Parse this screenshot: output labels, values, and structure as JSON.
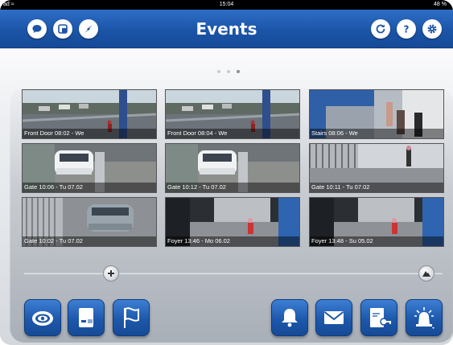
{
  "statusbar": {
    "left": "ad ≈",
    "time": "15:04",
    "right": "48 %"
  },
  "navbar": {
    "title": "Events",
    "left_buttons": [
      "chat-icon",
      "window-icon",
      "compass-icon"
    ],
    "right_buttons": [
      "refresh-icon",
      "help-icon",
      "settings-icon"
    ]
  },
  "pager": {
    "pages": 3,
    "active": 3
  },
  "events": [
    {
      "caption": "Front Door 08:02 - We",
      "scene": "parking"
    },
    {
      "caption": "Front Door 08:04 - We",
      "scene": "parking"
    },
    {
      "caption": "Stairs 08:06 - We",
      "scene": "stairs"
    },
    {
      "caption": "Gate 10:06 - Tu 07.02",
      "scene": "car-white"
    },
    {
      "caption": "Gate 10:12 - Tu 07.02",
      "scene": "car-white"
    },
    {
      "caption": "Gate 10:11 - Tu 07.02",
      "scene": "fence"
    },
    {
      "caption": "Gate 10:02 - Tu 07.02",
      "scene": "car-grey"
    },
    {
      "caption": "Foyer 13:46 - Mo 06.02",
      "scene": "foyer"
    },
    {
      "caption": "Foyer 13:48 - Su 05.02",
      "scene": "foyer"
    }
  ],
  "slider": {
    "left_icon": "plus-icon",
    "right_icon": "mountain-icon",
    "value": 1.0
  },
  "toolbar": {
    "left": [
      "camera-dome-icon",
      "card-reader-icon",
      "flag-icon"
    ],
    "right": [
      "bell-icon",
      "mail-icon",
      "door-key-icon",
      "alarm-light-icon"
    ]
  },
  "colors": {
    "accent": "#1b55a8",
    "background": "#e3e6ea"
  }
}
